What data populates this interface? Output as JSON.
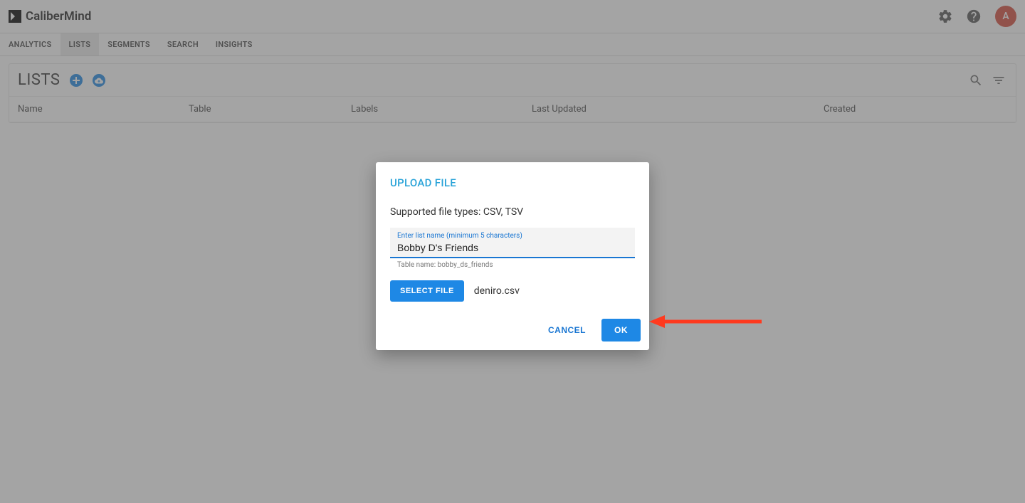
{
  "header": {
    "brand": "CaliberMind",
    "avatar_letter": "A"
  },
  "nav": {
    "tabs": [
      "ANALYTICS",
      "LISTS",
      "SEGMENTS",
      "SEARCH",
      "INSIGHTS"
    ],
    "active_index": 1
  },
  "panel": {
    "title": "LISTS",
    "columns": [
      "Name",
      "Table",
      "Labels",
      "Last Updated",
      "Created"
    ]
  },
  "dialog": {
    "title": "UPLOAD FILE",
    "supported_text": "Supported file types: CSV, TSV",
    "input_label": "Enter list name (minimum 5 characters)",
    "input_value": "Bobby D's Friends",
    "helper_text": "Table name: bobby_ds_friends",
    "select_file_label": "SELECT FILE",
    "selected_file": "deniro.csv",
    "cancel_label": "CANCEL",
    "ok_label": "OK"
  },
  "colors": {
    "accent": "#1e88e5",
    "avatar": "#d54a3a",
    "arrow": "#ff3a1f"
  }
}
